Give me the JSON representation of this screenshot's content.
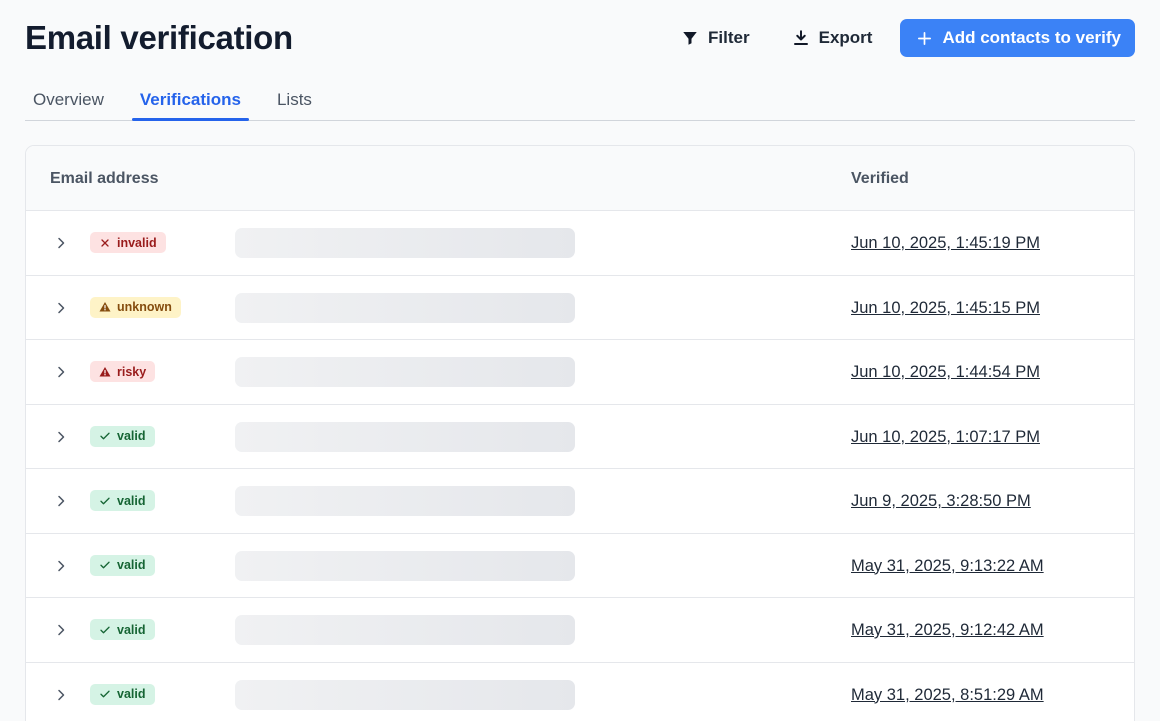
{
  "page": {
    "title": "Email verification"
  },
  "toolbar": {
    "filter_label": "Filter",
    "export_label": "Export",
    "add_label": "Add contacts to verify"
  },
  "tabs": [
    {
      "label": "Overview",
      "active": false
    },
    {
      "label": "Verifications",
      "active": true
    },
    {
      "label": "Lists",
      "active": false
    }
  ],
  "table": {
    "columns": {
      "email": "Email address",
      "verified": "Verified"
    },
    "rows": [
      {
        "status": "invalid",
        "status_label": "invalid",
        "status_icon": "x-icon",
        "verified": "Jun 10, 2025, 1:45:19 PM"
      },
      {
        "status": "unknown",
        "status_label": "unknown",
        "status_icon": "warning-icon",
        "verified": "Jun 10, 2025, 1:45:15 PM"
      },
      {
        "status": "risky",
        "status_label": "risky",
        "status_icon": "warning-icon",
        "verified": "Jun 10, 2025, 1:44:54 PM"
      },
      {
        "status": "valid",
        "status_label": "valid",
        "status_icon": "check-icon",
        "verified": "Jun 10, 2025, 1:07:17 PM"
      },
      {
        "status": "valid",
        "status_label": "valid",
        "status_icon": "check-icon",
        "verified": "Jun 9, 2025, 3:28:50 PM"
      },
      {
        "status": "valid",
        "status_label": "valid",
        "status_icon": "check-icon",
        "verified": "May 31, 2025, 9:13:22 AM"
      },
      {
        "status": "valid",
        "status_label": "valid",
        "status_icon": "check-icon",
        "verified": "May 31, 2025, 9:12:42 AM"
      },
      {
        "status": "valid",
        "status_label": "valid",
        "status_icon": "check-icon",
        "verified": "May 31, 2025, 8:51:29 AM"
      }
    ]
  },
  "colors": {
    "accent": "#3b82f6",
    "active_tab": "#2563eb",
    "invalid_bg": "#fde2e2",
    "unknown_bg": "#fef3c7",
    "valid_bg": "#d5f3e5"
  }
}
